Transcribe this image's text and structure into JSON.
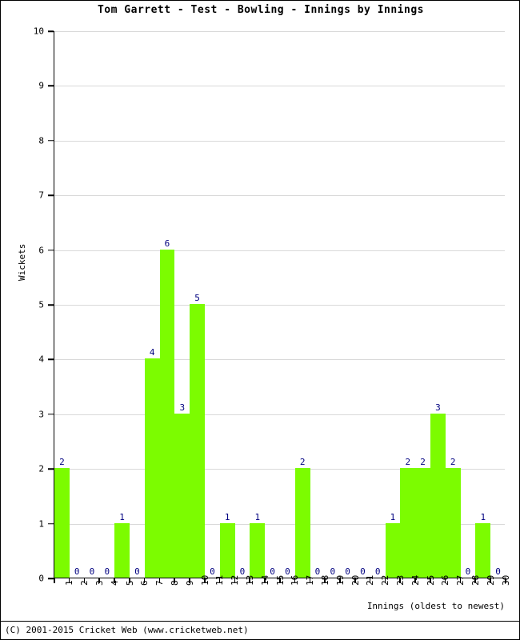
{
  "chart_data": {
    "type": "bar",
    "title": "Tom Garrett - Test - Bowling - Innings by Innings",
    "xlabel": "Innings (oldest to newest)",
    "ylabel": "Wickets",
    "ylim": [
      0,
      10
    ],
    "ytick_labels": [
      "0",
      "1",
      "2",
      "3",
      "4",
      "5",
      "6",
      "7",
      "8",
      "9",
      "10"
    ],
    "grid": true,
    "legend": "none",
    "categories": [
      "1",
      "2",
      "3",
      "4",
      "5",
      "6",
      "7",
      "8",
      "9",
      "10",
      "11",
      "12",
      "13",
      "14",
      "15",
      "16",
      "17",
      "18",
      "19",
      "20",
      "21",
      "22",
      "23",
      "24",
      "25",
      "26",
      "27",
      "28",
      "29",
      "30"
    ],
    "values": [
      2,
      0,
      0,
      0,
      1,
      0,
      4,
      6,
      3,
      5,
      0,
      1,
      0,
      1,
      0,
      0,
      2,
      0,
      0,
      0,
      0,
      0,
      1,
      2,
      2,
      3,
      2,
      0,
      1,
      0
    ],
    "value_labels": [
      "2",
      "0",
      "0",
      "0",
      "1",
      "0",
      "4",
      "6",
      "3",
      "5",
      "0",
      "1",
      "0",
      "1",
      "0",
      "0",
      "2",
      "0",
      "0",
      "0",
      "0",
      "0",
      "1",
      "2",
      "2",
      "3",
      "2",
      "0",
      "1",
      "0"
    ],
    "bar_color": "#7CFC00",
    "value_label_color": "#000080",
    "gridline_color": "#d9d9d9",
    "axis_color": "#000000"
  },
  "footer": {
    "copyright": "(C) 2001-2015 Cricket Web (www.cricketweb.net)"
  }
}
